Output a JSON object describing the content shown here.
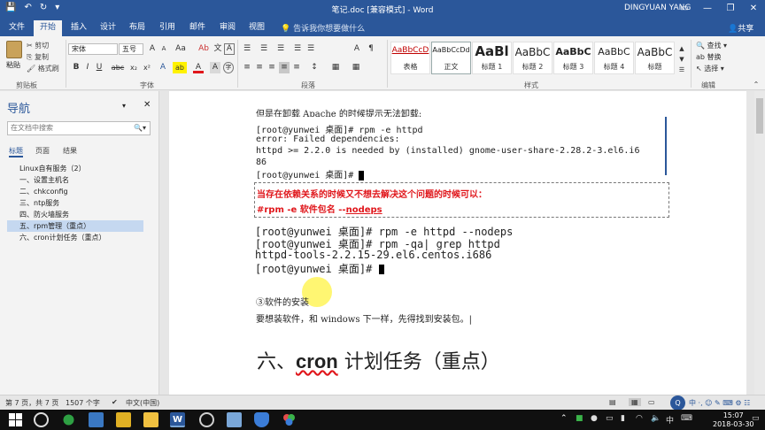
{
  "window": {
    "title": "笔记.doc [兼容模式] - Word",
    "user": "DINGYUAN YANG",
    "quick_access": [
      "💾",
      "↶",
      "↻",
      "▾"
    ]
  },
  "ribbon_tabs": [
    "文件",
    "开始",
    "插入",
    "设计",
    "布局",
    "引用",
    "邮件",
    "审阅",
    "视图"
  ],
  "tell_me": "告诉我你想要做什么",
  "share_label": "共享",
  "ribbon": {
    "clipboard": {
      "paste": "粘贴",
      "cut": "剪切",
      "copy": "复制",
      "format_painter": "格式刷",
      "group": "剪贴板"
    },
    "font": {
      "font_name": "宋体",
      "font_size": "五号",
      "group": "字体",
      "row1_buttons": [
        "A",
        "A",
        "Aa",
        "Ab",
        "文",
        "A"
      ],
      "row2_buttons": [
        "B",
        "I",
        "U",
        "abc",
        "x₂",
        "x²",
        "A",
        "ab",
        "A",
        "A",
        "字"
      ]
    },
    "paragraph": {
      "group": "段落",
      "row1_buttons": [
        "☰",
        "☰",
        "☰",
        "☰",
        "☰",
        "A",
        "¶"
      ],
      "row2_buttons": [
        "≡",
        "≡",
        "≡",
        "≡",
        "≡",
        "↕",
        "▦",
        "▦"
      ]
    },
    "styles": {
      "group": "样式",
      "items": [
        {
          "sample": "AaBbCcD",
          "name": "表格"
        },
        {
          "sample": "AaBbCcDd",
          "name": "正文"
        },
        {
          "sample": "AaBl",
          "name": "标题 1"
        },
        {
          "sample": "AaBbC",
          "name": "标题 2"
        },
        {
          "sample": "AaBbC",
          "name": "标题 3"
        },
        {
          "sample": "AaBbC",
          "name": "标题 4"
        },
        {
          "sample": "AaBbC",
          "name": "标题"
        }
      ]
    },
    "editing": {
      "group": "编辑",
      "find": "查找",
      "replace": "替换",
      "select": "选择"
    }
  },
  "nav": {
    "title": "导航",
    "search_placeholder": "在文档中搜索",
    "tabs": [
      "标题",
      "页面",
      "结果"
    ],
    "items": [
      {
        "label": "Linux自有服务（2）"
      },
      {
        "label": "一、设置主机名"
      },
      {
        "label": "二、chkconfig"
      },
      {
        "label": "三、ntp服务"
      },
      {
        "label": "四、防火墙服务"
      },
      {
        "label": "五、rpm管理（重点）"
      },
      {
        "label": "六、cron计划任务（重点）"
      }
    ]
  },
  "document": {
    "p1": "但是在卸载 Apache 的时候提示无法卸载:",
    "img1_lines": [
      "[root@yunwei 桌面]# rpm -e httpd",
      "error: Failed dependencies:",
      "        httpd >= 2.2.0 is needed by (installed) gnome-user-share-2.28.2-3.el6.i6",
      "86",
      "[root@yunwei 桌面]# "
    ],
    "note_line1": "当存在依赖关系的时候又不想去解决这个问题的时候可以：",
    "note_line2_prefix": "#rpm -e 软件包名 --",
    "note_line2_flag": "nodeps",
    "shell_lines": [
      "[root@yunwei 桌面]# rpm -e httpd --nodeps",
      "[root@yunwei 桌面]# rpm -qa| grep httpd",
      "httpd-tools-2.2.15-29.el6.centos.i686",
      "[root@yunwei 桌面]# "
    ],
    "section3": "③软件的安装",
    "p2": "要想装软件，和 windows 下一样，先得找到安装包。|",
    "heading_prefix": "六、",
    "heading_cron": "cron",
    "heading_suffix": " 计划任务（重点）"
  },
  "status": {
    "page": "第 7 页，共 7 页",
    "words": "1507 个字",
    "language": "中文(中国)",
    "ime": "中 ·, ☺ ✎ ⌨ ⚙ ☷"
  },
  "clock": {
    "time": "15:07",
    "date": "2018-03-30"
  },
  "taskbar_icons": [
    {
      "name": "start",
      "color": "#ffffff"
    },
    {
      "name": "search",
      "color": "#dddddd"
    },
    {
      "name": "app-green",
      "color": "#2ea043"
    },
    {
      "name": "app-monitor",
      "color": "#3a78c2"
    },
    {
      "name": "app-yellow",
      "color": "#e0b024"
    },
    {
      "name": "explorer",
      "color": "#f0c040"
    },
    {
      "name": "word",
      "color": "#2b579a"
    },
    {
      "name": "app-circle",
      "color": "#cfcfcf"
    },
    {
      "name": "app-tools",
      "color": "#7aa7d8"
    },
    {
      "name": "app-shield",
      "color": "#3b7dd8"
    },
    {
      "name": "app-colors",
      "color": "#e34b4b"
    }
  ]
}
